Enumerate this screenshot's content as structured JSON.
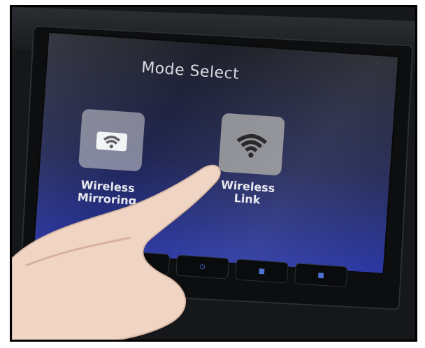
{
  "screen": {
    "title": "Mode Select",
    "options": [
      {
        "label": "Wireless\nMirroring",
        "icon": "wifi-phone-icon",
        "state": "unselected"
      },
      {
        "label": "Wireless\nLink",
        "icon": "wifi-icon",
        "state": "selected"
      }
    ]
  },
  "colors": {
    "screen_blue": "#2330a0",
    "tile_selected": "#8a8c92",
    "text": "#e7e8ee"
  },
  "hardware_buttons": {
    "icons": [
      "button-icon",
      "power-icon",
      "button-icon",
      "button-icon"
    ]
  }
}
